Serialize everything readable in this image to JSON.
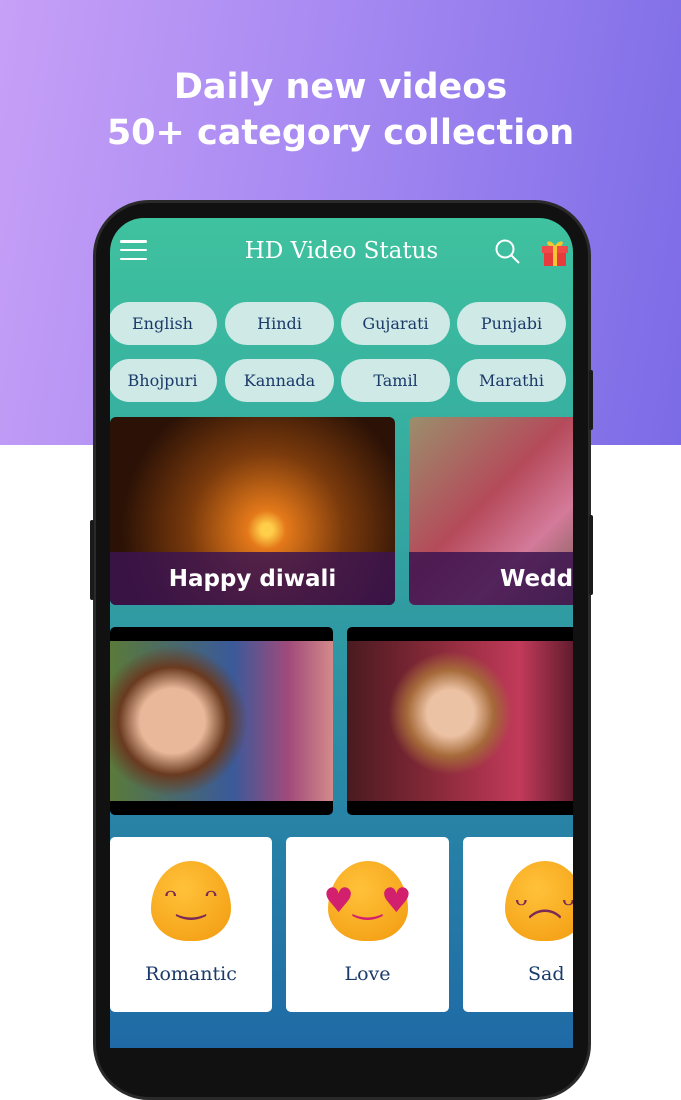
{
  "promo": {
    "line1": "Daily new videos",
    "line2": "50+ category collection"
  },
  "app": {
    "title": "HD Video Status",
    "icons": [
      "menu-icon",
      "search-icon",
      "gift-icon"
    ]
  },
  "languages": [
    "English",
    "Hindi",
    "Gujarati",
    "Punjabi",
    "Bhojpuri",
    "Kannada",
    "Tamil",
    "Marathi"
  ],
  "banners": [
    {
      "label": "Happy diwali"
    },
    {
      "label": "Wedding"
    }
  ],
  "categories": [
    {
      "label": "Romantic",
      "icon": "romantic-emoji-icon"
    },
    {
      "label": "Love",
      "icon": "love-emoji-icon"
    },
    {
      "label": "Sad",
      "icon": "sad-emoji-icon"
    }
  ],
  "colors": {
    "chip_bg": "#cfe9e6",
    "chip_text": "#1a3a6a",
    "header_teal": "#3fc29f",
    "promo_purple": "#a387f1"
  }
}
